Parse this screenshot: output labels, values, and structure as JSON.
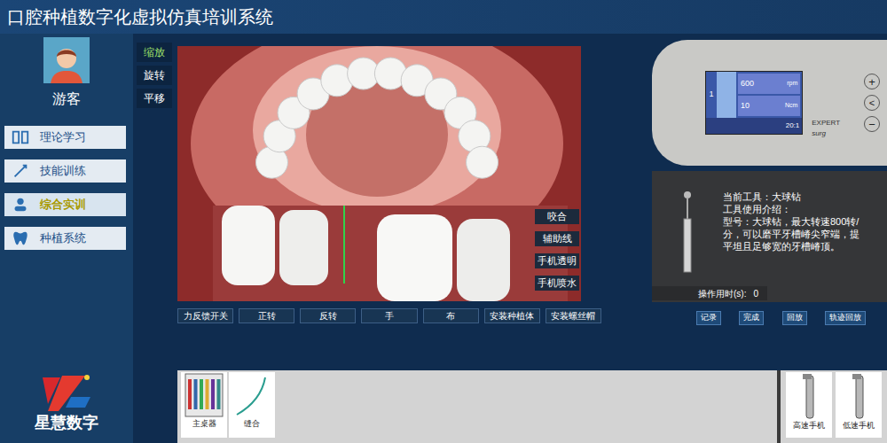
{
  "window": {
    "title": "口腔种植数字化虚拟仿真培训系统"
  },
  "user": {
    "name": "游客"
  },
  "menu": [
    {
      "label": "理论学习",
      "selected": false
    },
    {
      "label": "技能训练",
      "selected": false
    },
    {
      "label": "综合实训",
      "selected": true
    },
    {
      "label": "种植系统",
      "selected": false
    }
  ],
  "logo": {
    "text": "星慧数字"
  },
  "view_modes": [
    {
      "label": "缩放",
      "selected": true
    },
    {
      "label": "旋转",
      "selected": false
    },
    {
      "label": "平移",
      "selected": false
    }
  ],
  "overlay_buttons": [
    "咬合",
    "辅助线",
    "手机透明",
    "手机喷水"
  ],
  "action_buttons": [
    "力反馈开关",
    "正转",
    "反转",
    "手",
    "布",
    "安装种植体",
    "安装螺丝帽"
  ],
  "device": {
    "program": "1",
    "speed": "600",
    "speed_unit": "rpm",
    "torque": "10",
    "torque_unit": "Ncm",
    "ratio": "20:1",
    "brand": "EXPERT",
    "brand_suffix": "surg",
    "plus": "+",
    "minus": "−",
    "back": "<"
  },
  "tool_info": {
    "current": "当前工具：大球钻",
    "intro": "工具使用介绍：",
    "lines": [
      "型号：大球钻，最大转速800转/",
      "分，可以磨平牙槽嵴尖窄端，提",
      "平坦且足够宽的牙槽嵴顶。"
    ]
  },
  "timer": {
    "label": "操作用时(s):",
    "value": "0"
  },
  "record_buttons": [
    "记录",
    "完成",
    "回放",
    "轨迹回放"
  ],
  "tray": [
    "主桌器",
    "缝合"
  ],
  "handpieces": [
    "高速手机",
    "低速手机"
  ]
}
